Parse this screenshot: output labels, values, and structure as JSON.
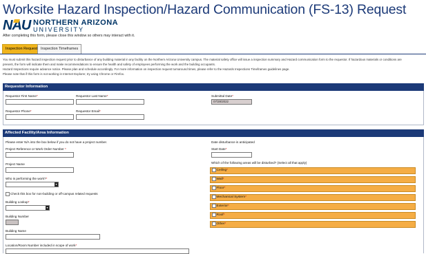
{
  "page": {
    "title": "Worksite Hazard Inspection/Hazard Communication (FS-13) Request",
    "logo_text_line1": "NORTHERN ARIZONA",
    "logo_text_line2": "UNIVERSITY",
    "logo_mark": "NAU",
    "note": "After completing this form, please close this window so others may interact with it."
  },
  "tabs": [
    {
      "label": "Inspection Request",
      "active": true
    },
    {
      "label": "Inspection Timeframes",
      "active": false
    }
  ],
  "intro": {
    "line1": "You must submit this hazard inspection request prior to disturbance of any building material in any facility on the Northern Arizona University campus. The material safety office will issue a inspection summary and Hazard communication form to the requestor. If hazardous materials or conditions are",
    "line2": "present, the form will indicate them and make recommendations to ensure the health and safety of employees performing the work and the building occupants.",
    "line3": "Hazard Inspections require advance notice. Please plan and schedule accordingly. For more information on inspection request turnaround times, please refer to the Hazards Inspections Timeframes guidelines page.",
    "line4": "Please note that if this form is not working in Internet Explorer, try using Chrome or Firefox."
  },
  "requestor": {
    "heading": "Requestor Information",
    "first_name_label": "Requestor First Name",
    "last_name_label": "Requestor Last Name",
    "submittal_date_label": "Submittal Date",
    "submittal_date_value": "07/28/2022",
    "phone_label": "Requestor Phone",
    "email_label": "Requestor Email",
    "required_mark": "*"
  },
  "facility": {
    "heading": "Affected Facility/Area Information",
    "na_note": "Please enter N/A into the box below if you do not have a project number.",
    "project_ref_label": "Project Reference or Work Order Number",
    "project_name_label": "Project Name",
    "who_label": "Who is performing the work?",
    "non_building_label": "Check this box for non-building or off-campus related requests",
    "building_lookup_label": "Building Lookup",
    "building_number_label": "Building Number",
    "building_name_label": "Building Name",
    "location_label": "Location/Room Number included in scope of work",
    "date_note": "Date disturbance is anticipated",
    "start_date_label": "Start Date",
    "areas_question": "Which of the following areas will be disturbed? (Select all that apply)",
    "areas": [
      "Ceiling",
      "Wall",
      "Floor",
      "Mechanical System",
      "Exterior",
      "Roof",
      "Other"
    ],
    "required_mark": "*"
  },
  "colors": {
    "header_navy": "#1c3a78",
    "accent_gold": "#f0b41c",
    "area_orange": "#f5ad45"
  }
}
